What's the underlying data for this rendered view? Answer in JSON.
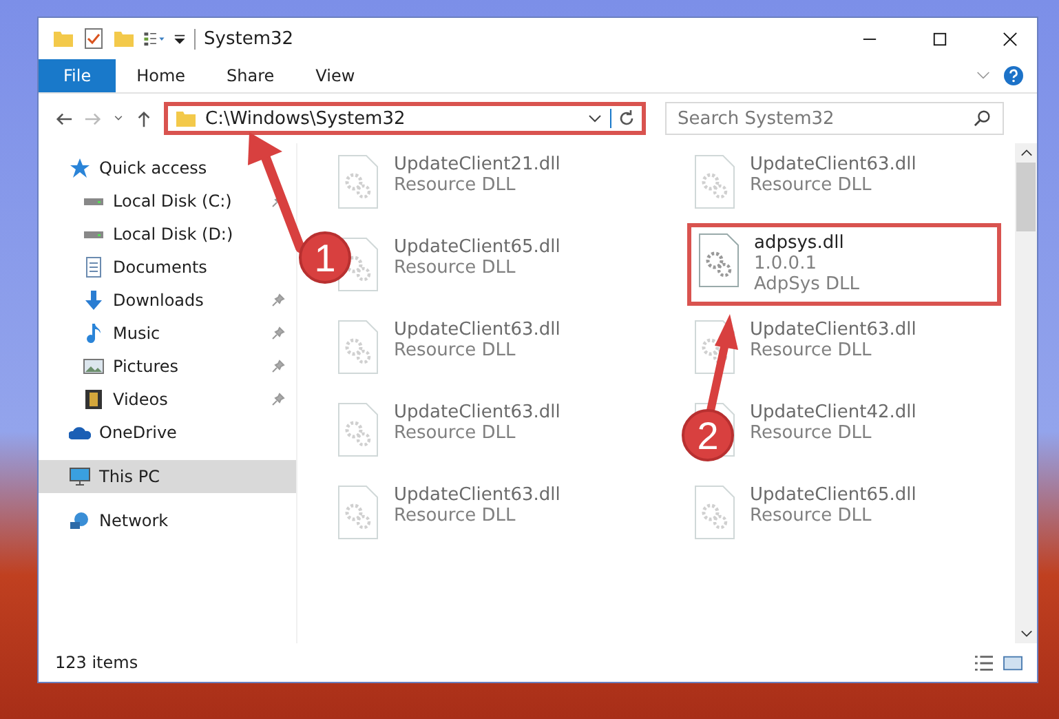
{
  "window": {
    "title": "System32"
  },
  "ribbon_tabs": [
    {
      "label": "File",
      "selected": true
    },
    {
      "label": "Home",
      "selected": false
    },
    {
      "label": "Share",
      "selected": false
    },
    {
      "label": "View",
      "selected": false
    }
  ],
  "address": {
    "path": "C:\\Windows\\System32",
    "highlighted": true
  },
  "search": {
    "placeholder": "Search System32"
  },
  "sidebar": {
    "items": [
      {
        "label": "Quick access",
        "kind": "star",
        "selected": false,
        "children": [
          {
            "label": "Local Disk (C:)",
            "kind": "drive",
            "pinned": true,
            "selected": false
          },
          {
            "label": "Local Disk (D:)",
            "kind": "drive",
            "pinned": false,
            "selected": false
          },
          {
            "label": "Documents",
            "kind": "docs",
            "pinned": false,
            "selected": false
          },
          {
            "label": "Downloads",
            "kind": "download",
            "pinned": true,
            "selected": false
          },
          {
            "label": "Music",
            "kind": "music",
            "pinned": true,
            "selected": false
          },
          {
            "label": "Pictures",
            "kind": "pictures",
            "pinned": true,
            "selected": false
          },
          {
            "label": "Videos",
            "kind": "videos",
            "pinned": true,
            "selected": false
          }
        ]
      },
      {
        "label": "OneDrive",
        "kind": "cloud",
        "selected": false
      },
      {
        "label": "This PC",
        "kind": "pc",
        "selected": true
      },
      {
        "label": "Network",
        "kind": "network",
        "selected": false
      }
    ]
  },
  "files": [
    {
      "name": "UpdateClient21.dll",
      "lines": [
        "Resource DLL"
      ],
      "highlighted": false
    },
    {
      "name": "UpdateClient63.dll",
      "lines": [
        "Resource DLL"
      ],
      "highlighted": false
    },
    {
      "name": "UpdateClient65.dll",
      "lines": [
        "Resource DLL"
      ],
      "highlighted": false
    },
    {
      "name": "adpsys.dll",
      "lines": [
        "1.0.0.1",
        "AdpSys DLL"
      ],
      "highlighted": true
    },
    {
      "name": "UpdateClient63.dll",
      "lines": [
        "Resource DLL"
      ],
      "highlighted": false
    },
    {
      "name": "UpdateClient63.dll",
      "lines": [
        "Resource DLL"
      ],
      "highlighted": false
    },
    {
      "name": "UpdateClient63.dll",
      "lines": [
        "Resource DLL"
      ],
      "highlighted": false
    },
    {
      "name": "UpdateClient42.dll",
      "lines": [
        "Resource DLL"
      ],
      "highlighted": false
    },
    {
      "name": "UpdateClient63.dll",
      "lines": [
        "Resource DLL"
      ],
      "highlighted": false
    },
    {
      "name": "UpdateClient65.dll",
      "lines": [
        "Resource DLL"
      ],
      "highlighted": false
    }
  ],
  "status_bar": {
    "count": "123 items"
  },
  "annotations": [
    {
      "number": "1"
    },
    {
      "number": "2"
    }
  ]
}
